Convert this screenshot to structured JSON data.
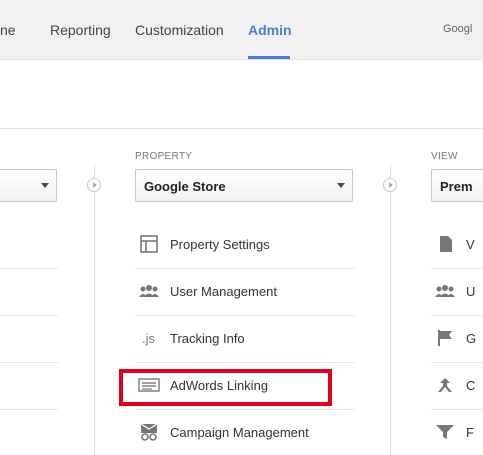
{
  "nav": {
    "tabs": [
      {
        "label": "ne"
      },
      {
        "label": "Reporting"
      },
      {
        "label": "Customization"
      },
      {
        "label": "Admin"
      }
    ],
    "account": "Googl"
  },
  "property": {
    "label": "PROPERTY",
    "selected": "Google Store",
    "items": [
      {
        "label": "Property Settings",
        "icon": "property-settings-icon"
      },
      {
        "label": "User Management",
        "icon": "users-icon"
      },
      {
        "label": "Tracking Info",
        "icon": "js-icon"
      },
      {
        "label": "AdWords Linking",
        "icon": "adwords-icon"
      },
      {
        "label": "Campaign Management",
        "icon": "campaign-icon"
      }
    ]
  },
  "view": {
    "label": "VIEW",
    "selected": "Prem",
    "item_letters": [
      "V",
      "U",
      "G",
      "C",
      "F"
    ]
  },
  "colors": {
    "accent": "#4a7fd0",
    "highlight": "#e0001b"
  }
}
